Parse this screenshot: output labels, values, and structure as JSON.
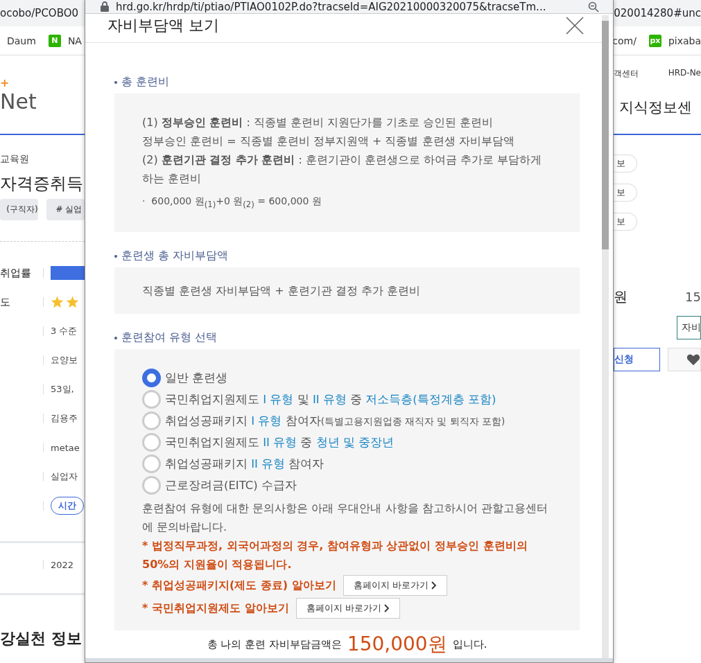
{
  "browser": {
    "url_left": "ocobo/PCOBO0",
    "url_right": "020014280#unc",
    "bookmarks_left": [
      {
        "label": "Daum"
      },
      {
        "label": "NA",
        "icon": "N"
      }
    ],
    "bookmarks_right": [
      {
        "label": "com/"
      },
      {
        "label": "pixaba",
        "icon": "px"
      }
    ]
  },
  "background_left": {
    "logo_mark": "+",
    "logo": "Net",
    "institute": "교육원",
    "course_title": "자격증취득",
    "tags": [
      "(구직자)",
      "# 실업"
    ],
    "rows": [
      {
        "label": "취업률",
        "kind": "bar"
      },
      {
        "label": "도",
        "kind": "stars"
      },
      {
        "label": "",
        "kind": "text",
        "value": "3 수준"
      },
      {
        "label": "",
        "kind": "text",
        "value": "요양보"
      },
      {
        "label": "",
        "kind": "text",
        "value": "53일,"
      },
      {
        "label": "",
        "kind": "text",
        "value": "김용주"
      },
      {
        "label": "",
        "kind": "text",
        "value": "metae"
      },
      {
        "label": "",
        "kind": "text",
        "value": "실업자"
      },
      {
        "label": "",
        "kind": "pill",
        "value": "시간"
      }
    ],
    "date": "2022",
    "bottom_heading": "강실천 정보"
  },
  "background_right": {
    "links": [
      "객센터",
      "HRD-Ne"
    ],
    "title": "지식정보센",
    "pills": [
      "보",
      "보",
      "보"
    ],
    "price_unit": "원",
    "price": "15",
    "cost_button": "자비",
    "apply_button": "신청"
  },
  "popup": {
    "url": "hrd.go.kr/hrdp/ti/ptiao/PTIAO0102P.do?tracseId=AIG20210000320075&tracseTm...",
    "title": "자비부담액 보기",
    "sections": [
      {
        "heading": "총 훈련비",
        "kind": "definitions",
        "lines": [
          "(1) **정부승인 훈련비** : 직종별 훈련비 지원단가를 기초로 승인된 훈련비",
          "정부승인 훈련비 = 직종별 훈련비 정부지원액 + 직종별 훈련생 자비부담액",
          "(2) **훈련기관 결정 추가 훈련비** : 훈련기관이 훈련생으로 하여금 추가로 부담하게 하는 훈련비"
        ],
        "formula": "·  600,000 원$_{(1)}$+0 원$_{(2)}$ = 600,000 원"
      },
      {
        "heading": "훈련생 총 자비부담액",
        "kind": "text",
        "lines": [
          "직종별 훈련생 자비부담액 + 훈련기관 결정 추가 훈련비"
        ]
      },
      {
        "heading": "훈련참여 유형 선택",
        "kind": "options",
        "options": [
          {
            "selected": true,
            "parts": [
              {
                "kind": "plain",
                "text": "일반 훈련생"
              }
            ]
          },
          {
            "selected": false,
            "parts": [
              {
                "kind": "plain",
                "text": "국민취업지원제도 "
              },
              {
                "kind": "highlight",
                "text": "I 유형"
              },
              {
                "kind": "plain",
                "text": " 및 "
              },
              {
                "kind": "highlight",
                "text": "II 유형"
              },
              {
                "kind": "plain",
                "text": " 중 "
              },
              {
                "kind": "highlight",
                "text": "저소득층(특정계층 포함)"
              }
            ]
          },
          {
            "selected": false,
            "parts": [
              {
                "kind": "plain",
                "text": "취업성공패키지 "
              },
              {
                "kind": "highlight",
                "text": "I 유형"
              },
              {
                "kind": "plain",
                "text": " 참여자"
              },
              {
                "kind": "small",
                "text": "(특별고용지원업종 재직자 및 퇴직자 포함)"
              }
            ]
          },
          {
            "selected": false,
            "parts": [
              {
                "kind": "plain",
                "text": "국민취업지원제도 "
              },
              {
                "kind": "highlight",
                "text": "II 유형"
              },
              {
                "kind": "plain",
                "text": " 중 "
              },
              {
                "kind": "highlight",
                "text": "청년 및 중장년"
              }
            ]
          },
          {
            "selected": false,
            "parts": [
              {
                "kind": "plain",
                "text": "취업성공패키지 "
              },
              {
                "kind": "highlight",
                "text": "II 유형"
              },
              {
                "kind": "plain",
                "text": " 참여자"
              }
            ]
          },
          {
            "selected": false,
            "parts": [
              {
                "kind": "plain",
                "text": "근로장려금(EITC) 수급자"
              }
            ]
          }
        ],
        "info": "훈련참여 유형에 대한 문의사항은 아래 우대안내 사항을 참고하시어 관할고용센터에 문의바랍니다.",
        "warning": "* 법정직무과정, 외국어과정의 경우, 참여유형과 상관없이 정부승인 훈련비의 50%의 지원율이 적용됩니다.",
        "links": [
          {
            "text": "* 취업성공패키지(제도 종료) 알아보기",
            "button": "홈페이지 바로가기"
          },
          {
            "text": "* 국민취업지원제도 알아보기",
            "button": "홈페이지 바로가기"
          }
        ]
      }
    ],
    "total": {
      "prefix": "총 나의 훈련 자비부담금액은",
      "amount": "150,000원",
      "suffix": "입니다."
    }
  }
}
